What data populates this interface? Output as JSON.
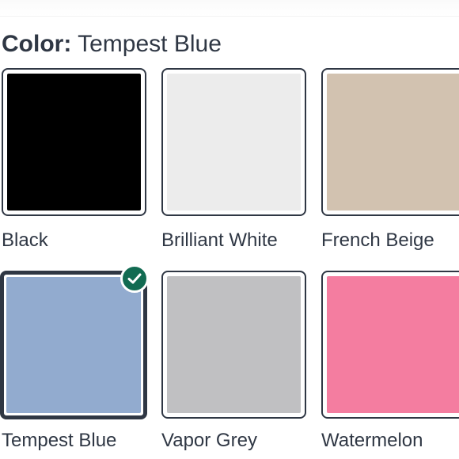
{
  "header": {
    "label": "Color:",
    "selected_value": "Tempest Blue"
  },
  "swatches": [
    {
      "name": "Black",
      "color": "#000000",
      "selected": false
    },
    {
      "name": "Brilliant White",
      "color": "#ececec",
      "selected": false
    },
    {
      "name": "French Beige",
      "color": "#d2c2b0",
      "selected": false
    },
    {
      "name": "Tempest Blue",
      "color": "#92abcf",
      "selected": true
    },
    {
      "name": "Vapor Grey",
      "color": "#c0c0c2",
      "selected": false
    },
    {
      "name": "Watermelon",
      "color": "#f47da0",
      "selected": false
    }
  ],
  "colors": {
    "border": "#2f3744",
    "check_badge": "#126b52"
  },
  "icons": {
    "selected_check": "checkmark-icon"
  }
}
